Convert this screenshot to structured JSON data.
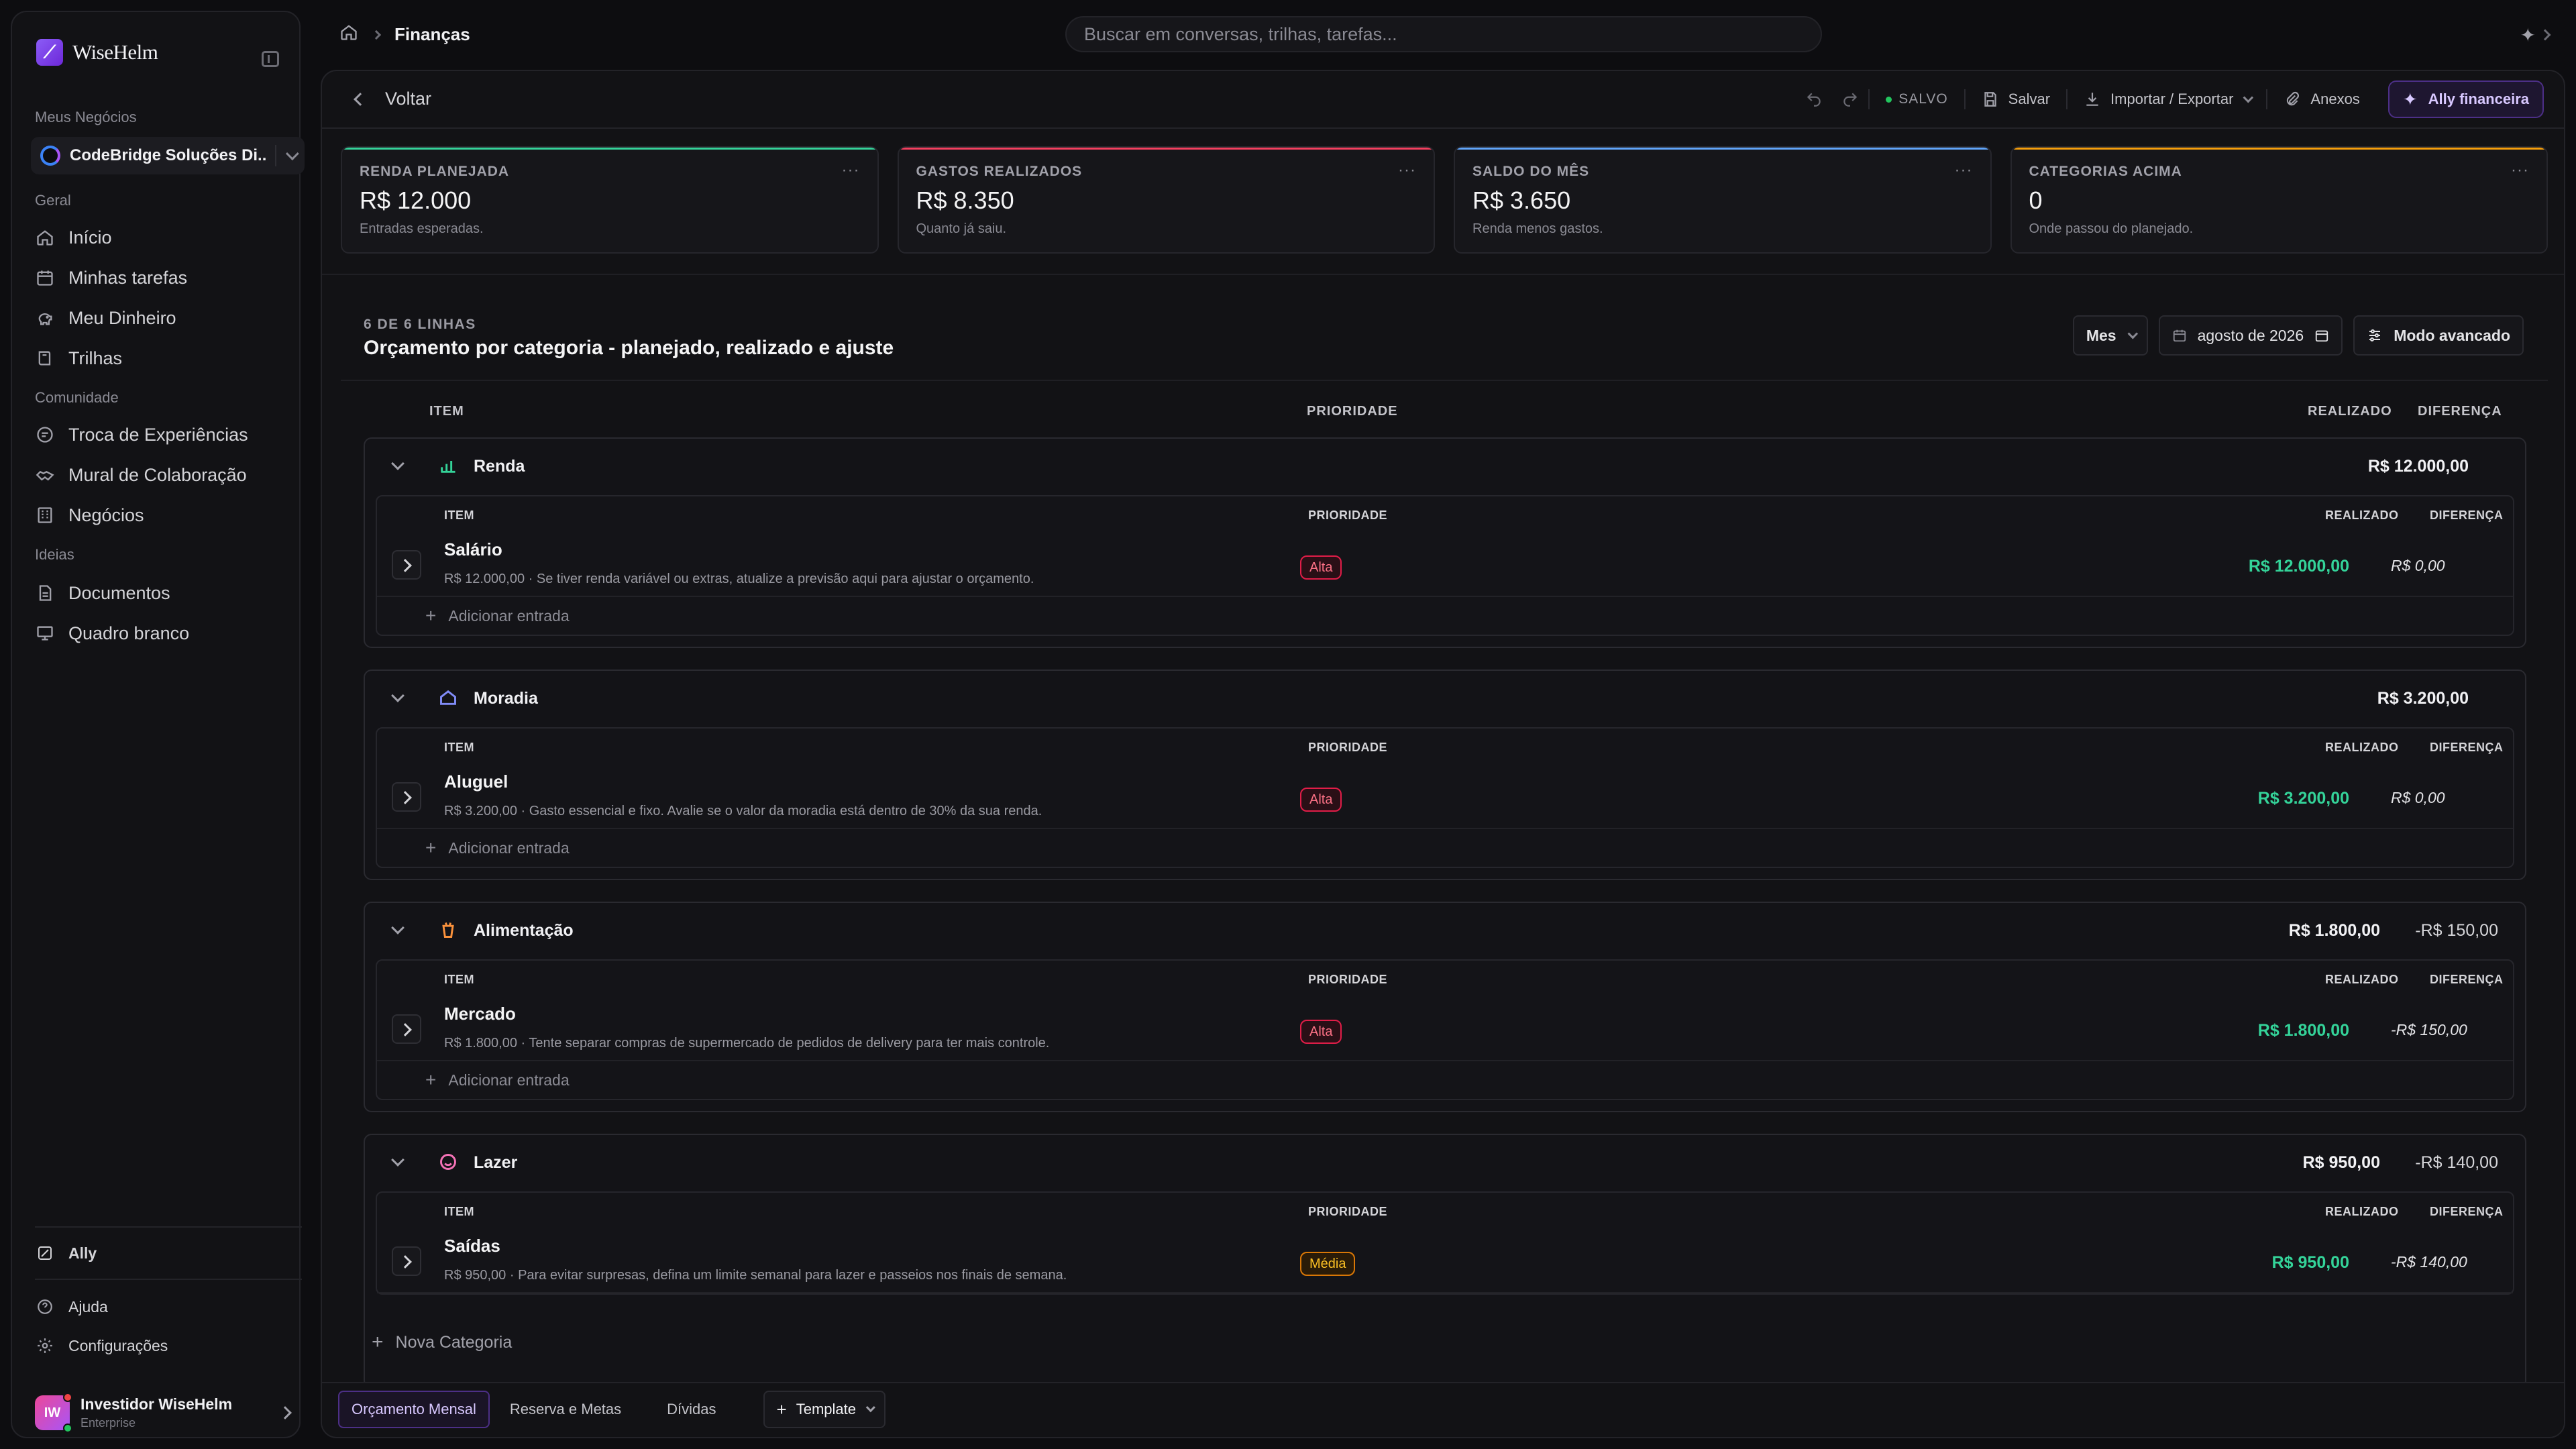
{
  "app": {
    "name": "WiseHelm"
  },
  "sidebar": {
    "business_label": "Meus Negócios",
    "business_name": "CodeBridge Soluções Di...",
    "sections": {
      "geral": "Geral",
      "comunidade": "Comunidade",
      "ideias": "Ideias"
    },
    "items": [
      {
        "label": "Início",
        "icon": "home-icon"
      },
      {
        "label": "Minhas tarefas",
        "icon": "calendar-icon"
      },
      {
        "label": "Meu Dinheiro",
        "icon": "piggy-bank-icon"
      },
      {
        "label": "Trilhas",
        "icon": "book-icon"
      },
      {
        "label": "Troca de Experiências",
        "icon": "chat-icon"
      },
      {
        "label": "Mural de Colaboração",
        "icon": "handshake-icon"
      },
      {
        "label": "Negócios",
        "icon": "building-icon"
      },
      {
        "label": "Documentos",
        "icon": "document-icon"
      },
      {
        "label": "Quadro branco",
        "icon": "whiteboard-icon"
      }
    ],
    "ally": "Ally",
    "help": "Ajuda",
    "settings": "Configurações",
    "user": {
      "initials": "IW",
      "name": "Investidor WiseHelm",
      "plan": "Enterprise"
    }
  },
  "header": {
    "breadcrumb": "Finanças",
    "search_placeholder": "Buscar em conversas, trilhas, tarefas..."
  },
  "toolbar": {
    "back": "Voltar",
    "status": "SALVO",
    "save": "Salvar",
    "import_export": "Importar / Exportar",
    "attachments": "Anexos",
    "ally_finance": "Ally financeira"
  },
  "cards": [
    {
      "label": "RENDA PLANEJADA",
      "value": "R$ 12.000",
      "sub": "Entradas esperadas.",
      "accent": "#34d399"
    },
    {
      "label": "GASTOS REALIZADOS",
      "value": "R$ 8.350",
      "sub": "Quanto já saiu.",
      "accent": "#f43f5e"
    },
    {
      "label": "SALDO DO MÊS",
      "value": "R$ 3.650",
      "sub": "Renda menos gastos.",
      "accent": "#60a5fa"
    },
    {
      "label": "CATEGORIAS ACIMA",
      "value": "0",
      "sub": "Onde passou do planejado.",
      "accent": "#f59e0b"
    }
  ],
  "budget": {
    "rows_count": "6 DE 6 LINHAS",
    "title": "Orçamento por categoria - planejado, realizado e ajuste",
    "period": "Mes",
    "date": "agosto de 2026",
    "advanced": "Modo avancado",
    "columns": {
      "item": "ITEM",
      "priority": "PRIORIDADE",
      "realized": "REALIZADO",
      "difference": "DIFERENÇA"
    },
    "add_entry": "Adicionar entrada",
    "groups": [
      {
        "name": "Renda",
        "icon": "chart-icon",
        "color": "#34d399",
        "total": "R$ 12.000,00",
        "diff": "",
        "item": {
          "name": "Salário",
          "desc": "R$ 12.000,00 · Se tiver renda variável ou extras, atualize a previsão aqui para ajustar o orçamento.",
          "priority": "Alta",
          "realized": "R$ 12.000,00",
          "diff": "R$ 0,00"
        }
      },
      {
        "name": "Moradia",
        "icon": "house-icon",
        "color": "#818cf8",
        "total": "R$ 3.200,00",
        "diff": "",
        "item": {
          "name": "Aluguel",
          "desc": "R$ 3.200,00 · Gasto essencial e fixo. Avalie se o valor da moradia está dentro de 30% da sua renda.",
          "priority": "Alta",
          "realized": "R$ 3.200,00",
          "diff": "R$ 0,00"
        }
      },
      {
        "name": "Alimentação",
        "icon": "cup-icon",
        "color": "#fb923c",
        "total": "R$ 1.800,00",
        "diff": "-R$ 150,00",
        "item": {
          "name": "Mercado",
          "desc": "R$ 1.800,00 · Tente separar compras de supermercado de pedidos de delivery para ter mais controle.",
          "priority": "Alta",
          "realized": "R$ 1.800,00",
          "diff": "-R$ 150,00"
        }
      },
      {
        "name": "Lazer",
        "icon": "smile-icon",
        "color": "#f472b6",
        "total": "R$ 950,00",
        "diff": "-R$ 140,00",
        "item": {
          "name": "Saídas",
          "desc": "R$ 950,00 · Para evitar surpresas, defina um limite semanal para lazer e passeios nos finais de semana.",
          "priority": "Média",
          "realized": "R$ 950,00",
          "diff": "-R$ 140,00"
        }
      }
    ],
    "new_category": "Nova Categoria"
  },
  "tabs": {
    "monthly": "Orçamento Mensal",
    "reserve": "Reserva e Metas",
    "debts": "Dívidas",
    "template": "Template"
  }
}
